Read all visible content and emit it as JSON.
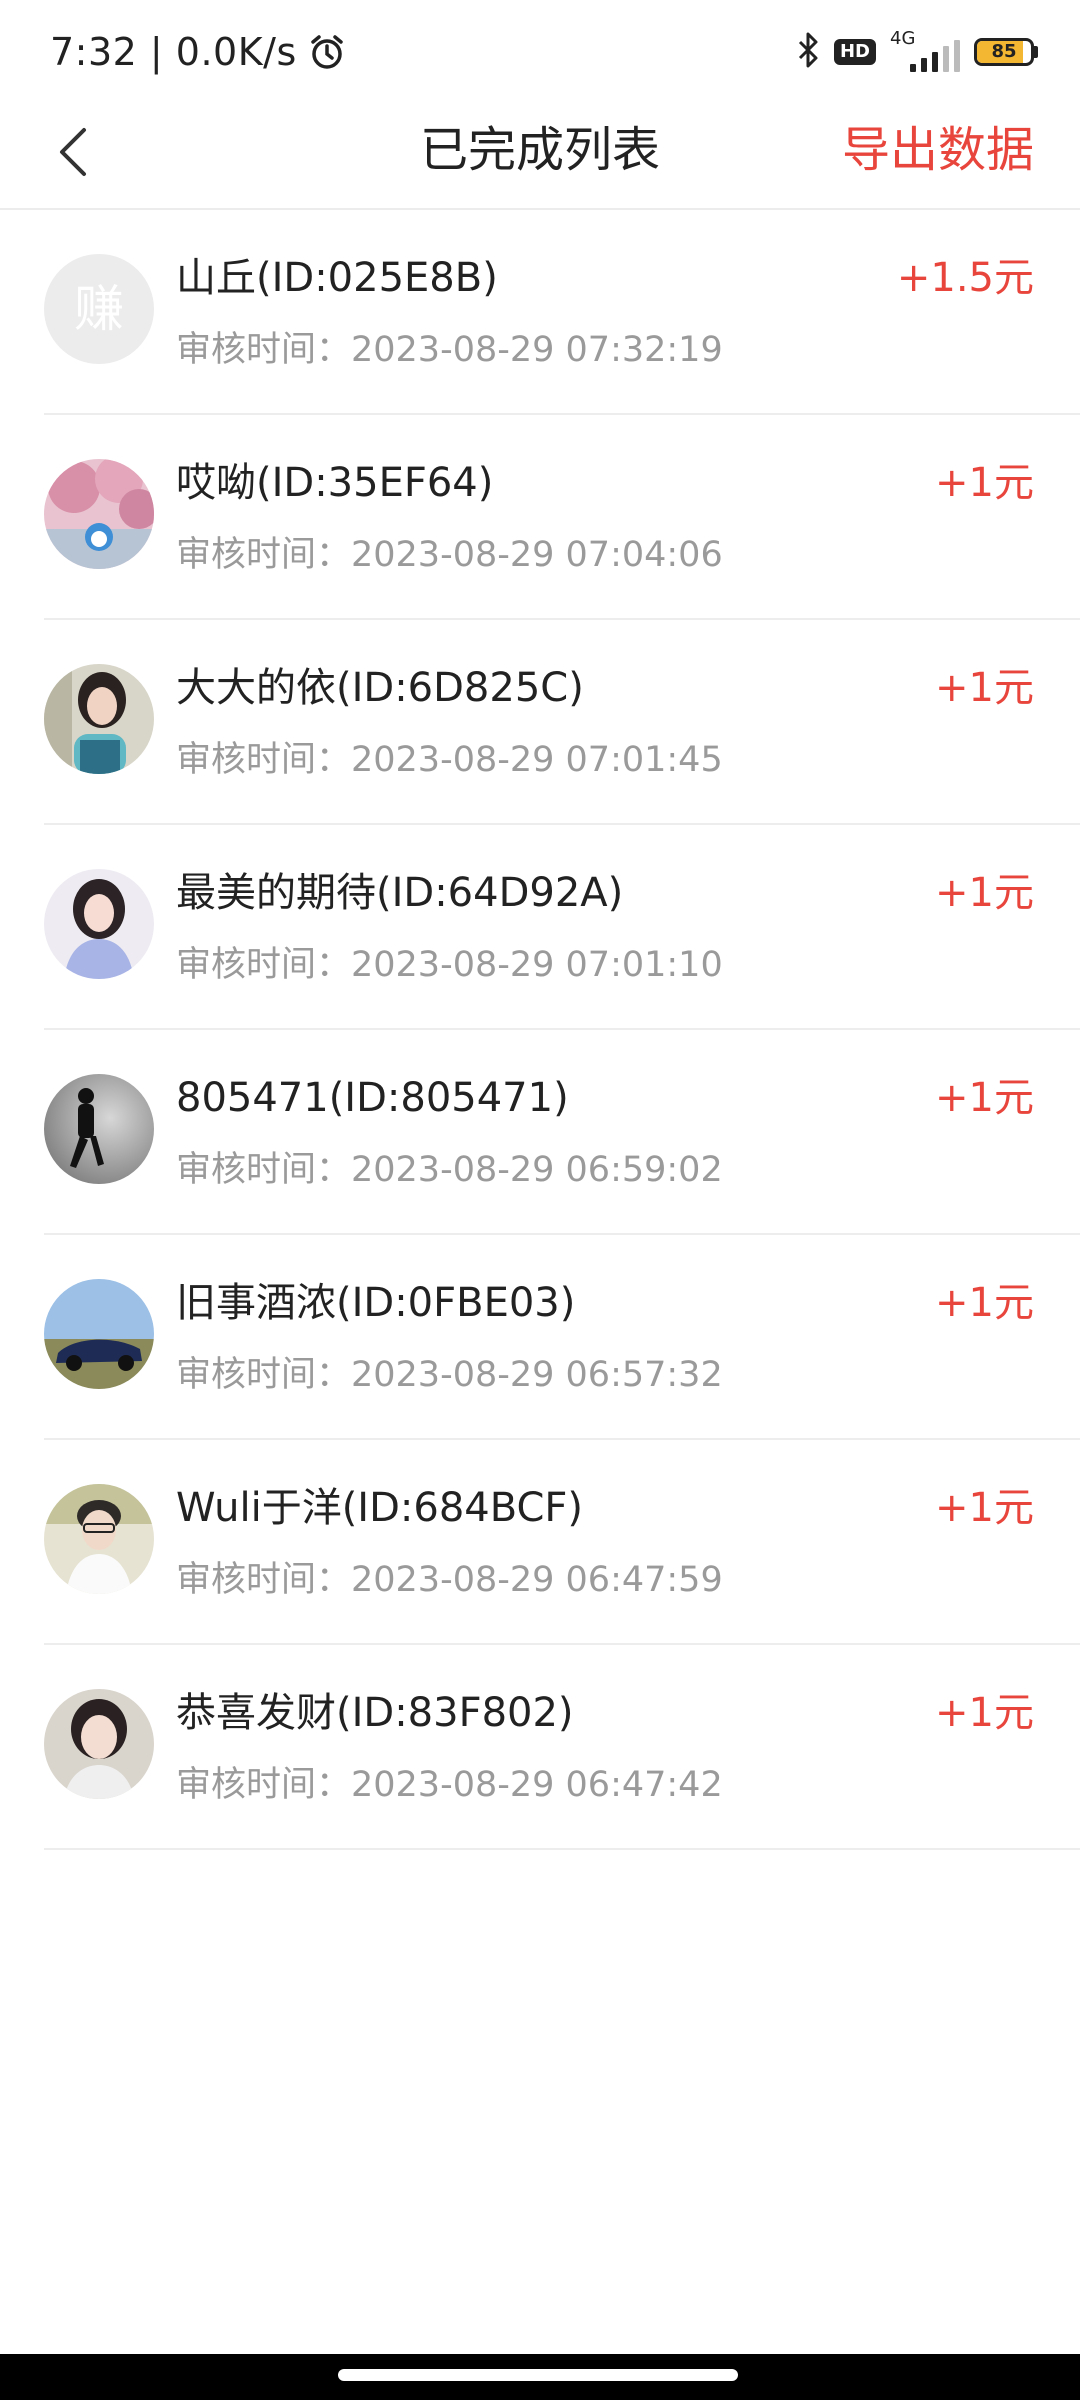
{
  "status_bar": {
    "time_speed": "7:32 | 0.0K/s",
    "hd_badge": "HD",
    "network_label": "4G",
    "battery": "85",
    "battery_level": 0.85
  },
  "header": {
    "title": "已完成列表",
    "export_label": "导出数据"
  },
  "records": [
    {
      "name": "山丘(ID:025E8B)",
      "time": "审核时间：2023-08-29 07:32:19",
      "amount": "+1.5元",
      "avatar_glyph": "赚"
    },
    {
      "name": "哎呦(ID:35EF64)",
      "time": "审核时间：2023-08-29 07:04:06",
      "amount": "+1元"
    },
    {
      "name": "大大的依(ID:6D825C)",
      "time": "审核时间：2023-08-29 07:01:45",
      "amount": "+1元"
    },
    {
      "name": "最美的期待(ID:64D92A)",
      "time": "审核时间：2023-08-29 07:01:10",
      "amount": "+1元"
    },
    {
      "name": "805471(ID:805471)",
      "time": "审核时间：2023-08-29 06:59:02",
      "amount": "+1元"
    },
    {
      "name": "旧事酒浓(ID:0FBE03)",
      "time": "审核时间：2023-08-29 06:57:32",
      "amount": "+1元"
    },
    {
      "name": "Wuli于洋(ID:684BCF)",
      "time": "审核时间：2023-08-29 06:47:59",
      "amount": "+1元"
    },
    {
      "name": "恭喜发财(ID:83F802)",
      "time": "审核时间：2023-08-29 06:47:42",
      "amount": "+1元"
    }
  ],
  "icons": {
    "back": "chevron-left-icon",
    "alarm": "alarm-clock-icon",
    "bluetooth": "bluetooth-icon",
    "signal": "signal-icon",
    "battery": "battery-icon"
  },
  "colors": {
    "accent": "#e8453c",
    "secondary_text": "#9a9a9a",
    "divider": "#ededed"
  }
}
